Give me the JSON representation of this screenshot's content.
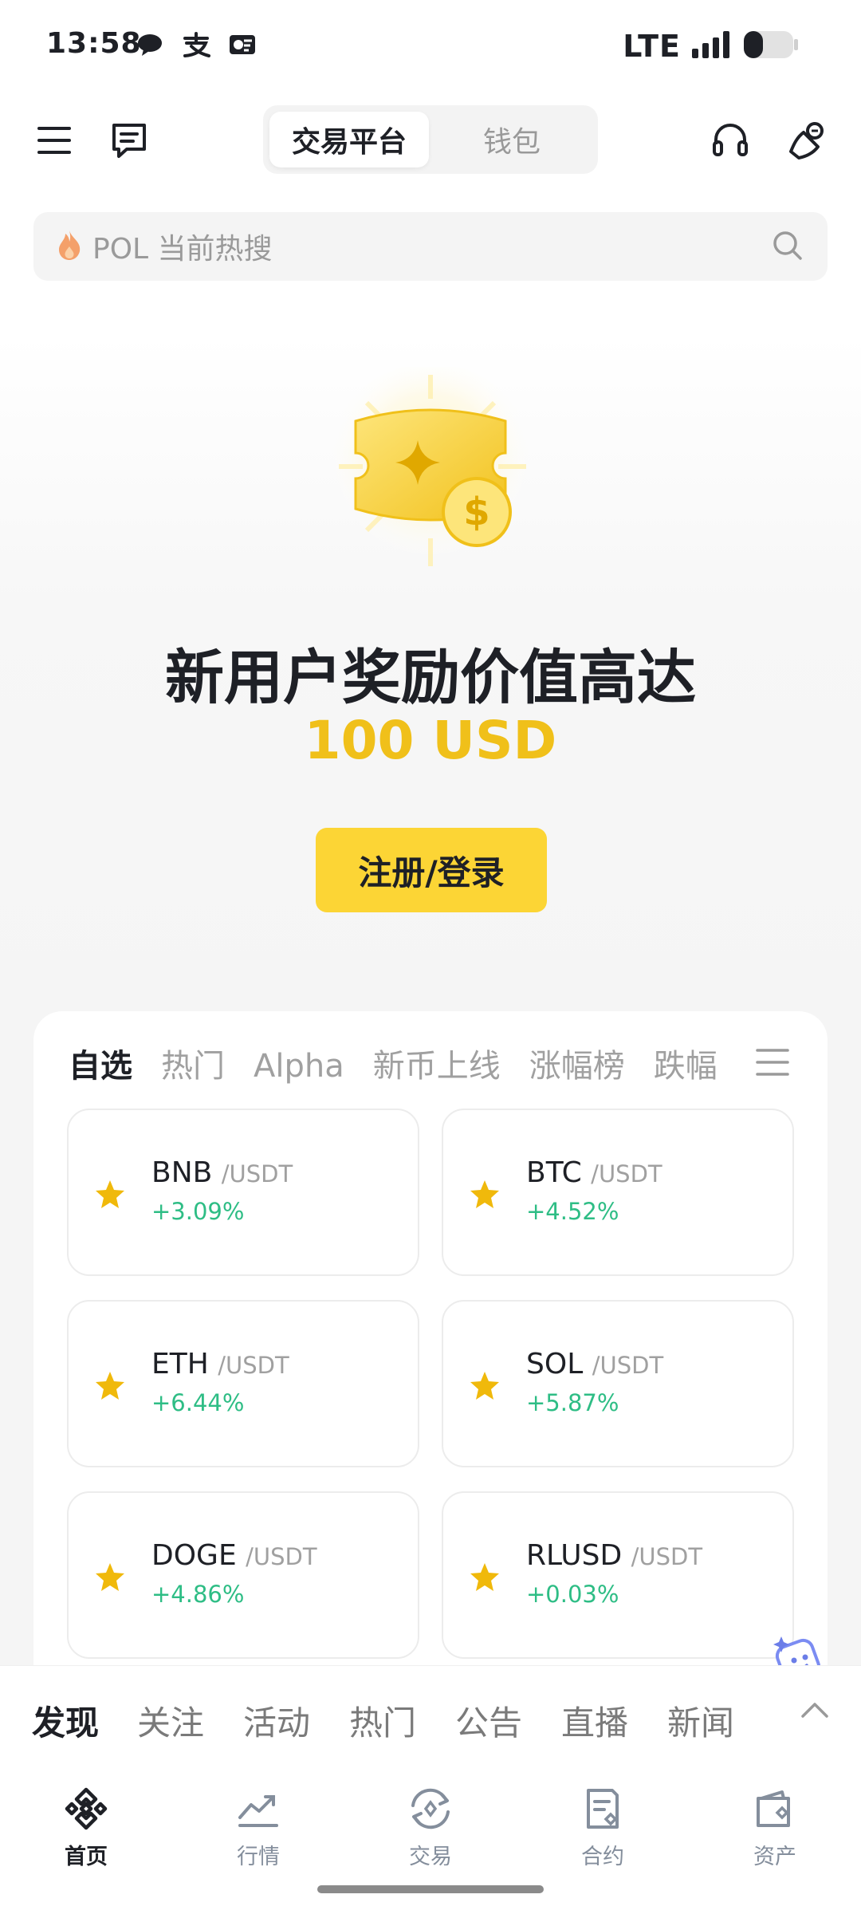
{
  "status_bar": {
    "time": "13:58",
    "network": "LTE",
    "app_icons": [
      "wechat-icon",
      "alipay-icon",
      "notification-icon"
    ],
    "battery_level": 0.35
  },
  "header": {
    "toggle_options": [
      "交易平台",
      "钱包"
    ],
    "active_option": "交易平台",
    "left_icons": [
      "menu-icon",
      "message-icon"
    ],
    "right_icons": [
      "headset-icon",
      "notification-bell-icon"
    ]
  },
  "search": {
    "text": "POL 当前热搜",
    "icon": "search-icon"
  },
  "hero": {
    "title": "新用户奖励价值高达",
    "amount": "100 USD",
    "button_label": "注册/登录",
    "accent_color": "#f0c01a",
    "button_color": "#fcd535"
  },
  "market": {
    "tabs": [
      "自选",
      "热门",
      "Alpha",
      "新币上线",
      "涨幅榜",
      "跌幅"
    ],
    "active_tab": "自选",
    "quote_suffix": "/USDT",
    "positive_color": "#2ebd85",
    "pairs": [
      {
        "symbol": "BNB",
        "quote": "/USDT",
        "change": "+3.09%"
      },
      {
        "symbol": "BTC",
        "quote": "/USDT",
        "change": "+4.52%"
      },
      {
        "symbol": "ETH",
        "quote": "/USDT",
        "change": "+6.44%"
      },
      {
        "symbol": "SOL",
        "quote": "/USDT",
        "change": "+5.87%"
      },
      {
        "symbol": "DOGE",
        "quote": "/USDT",
        "change": "+4.86%"
      },
      {
        "symbol": "RLUSD",
        "quote": "/USDT",
        "change": "+0.03%"
      }
    ]
  },
  "news_tabs": {
    "items": [
      "发现",
      "关注",
      "活动",
      "热门",
      "公告",
      "直播",
      "新闻"
    ],
    "active": "发现"
  },
  "bottom_nav": {
    "items": [
      {
        "label": "首页",
        "icon": "binance-logo-icon"
      },
      {
        "label": "行情",
        "icon": "chart-trend-icon"
      },
      {
        "label": "交易",
        "icon": "trade-swap-icon"
      },
      {
        "label": "合约",
        "icon": "futures-doc-icon"
      },
      {
        "label": "资产",
        "icon": "wallet-icon"
      }
    ],
    "active": "首页"
  }
}
